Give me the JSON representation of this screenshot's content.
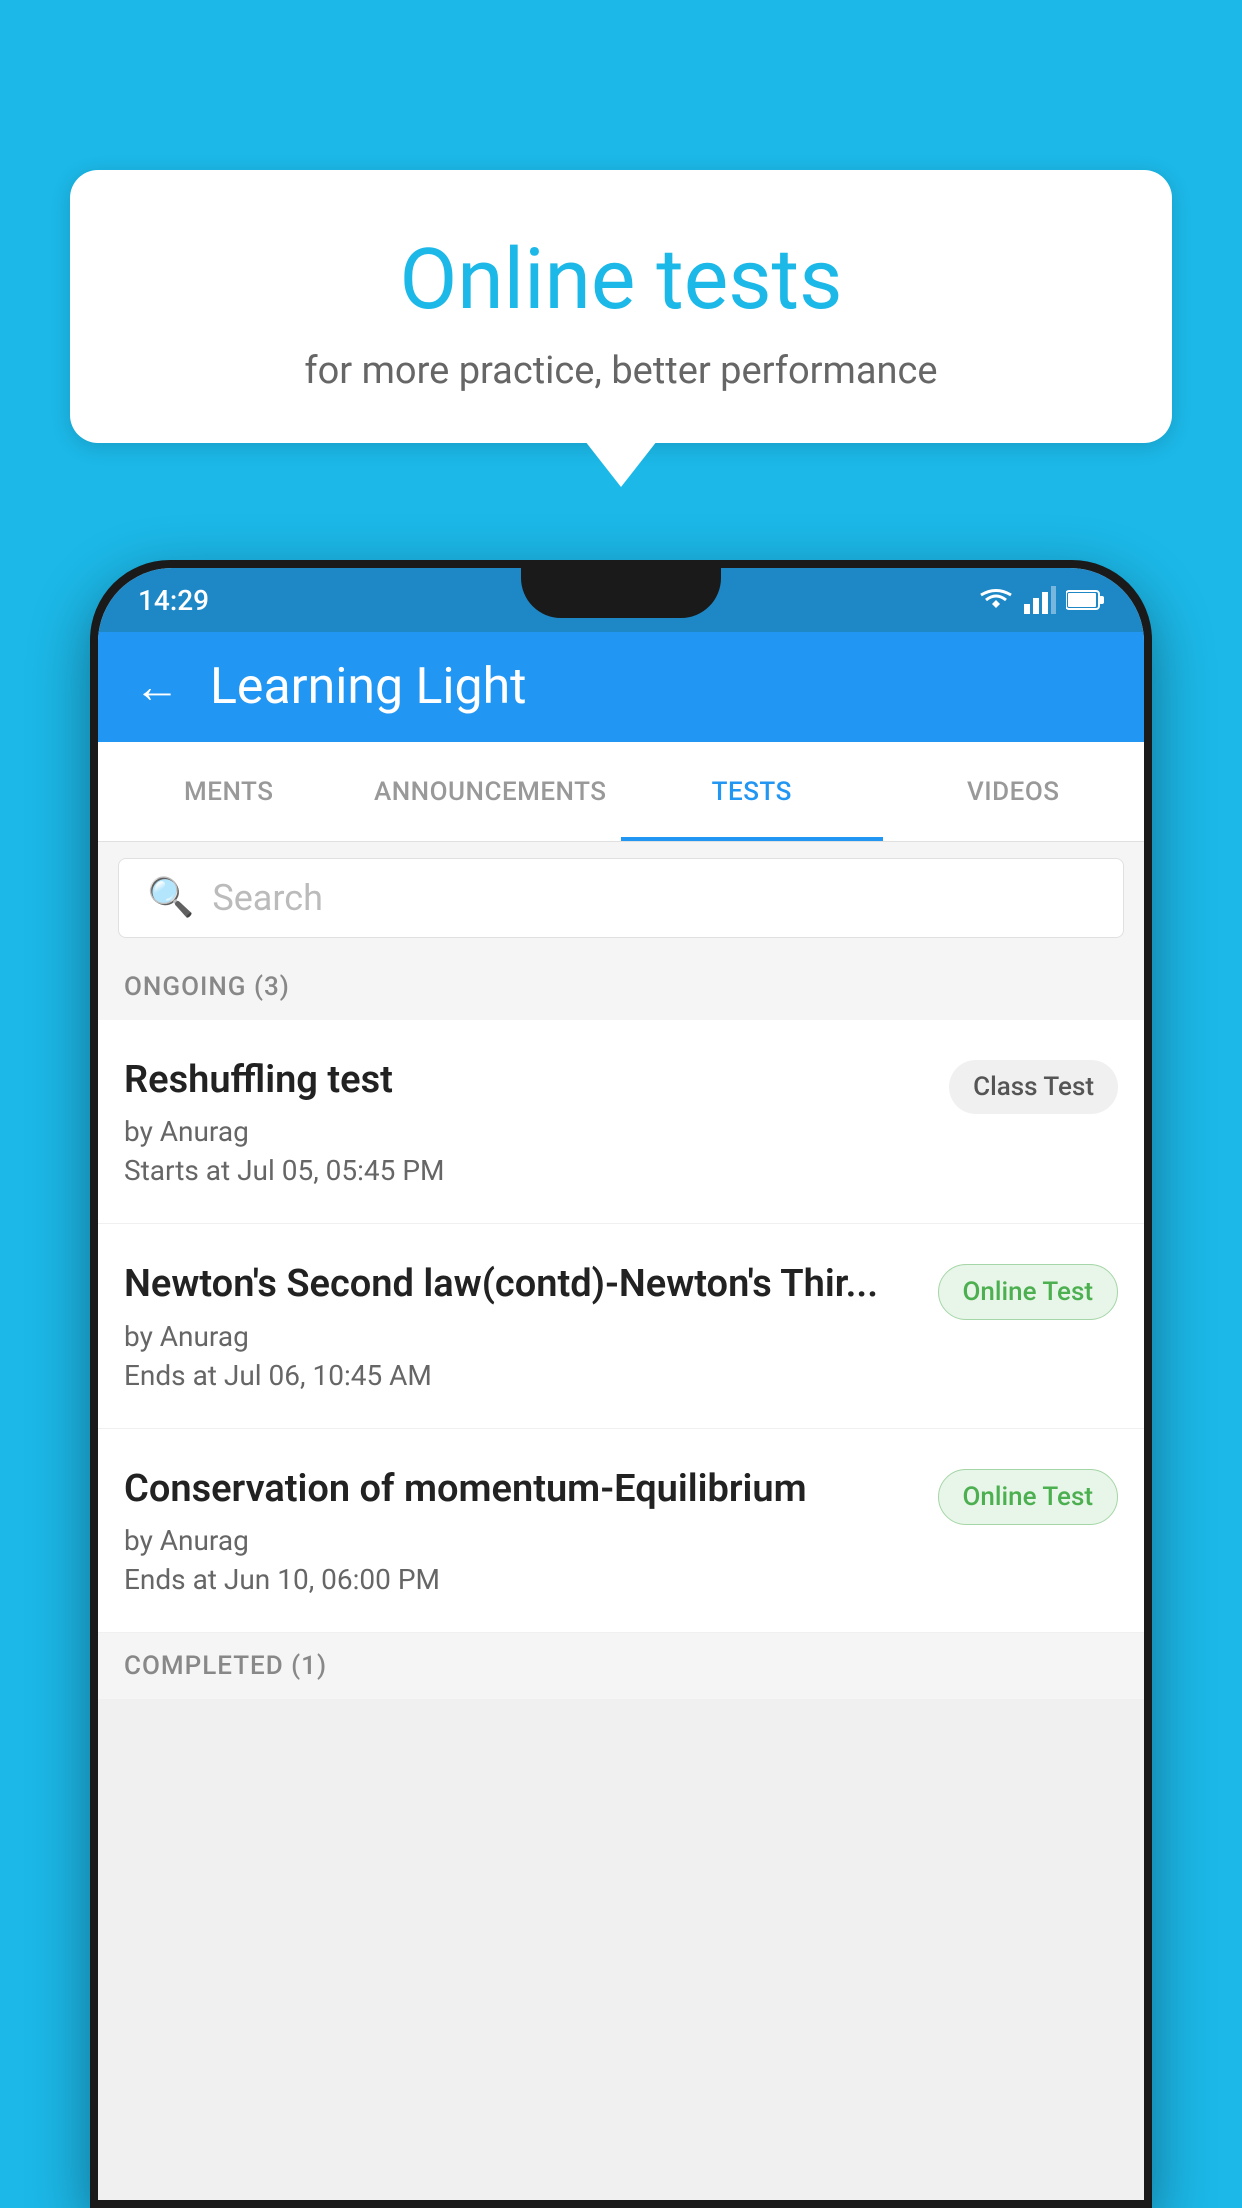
{
  "background": {
    "color": "#1CB8E8"
  },
  "bubble": {
    "title": "Online tests",
    "subtitle": "for more practice, better performance"
  },
  "status_bar": {
    "time": "14:29"
  },
  "app_bar": {
    "title": "Learning Light",
    "back_label": "←"
  },
  "tabs": [
    {
      "label": "MENTS",
      "active": false
    },
    {
      "label": "ANNOUNCEMENTS",
      "active": false
    },
    {
      "label": "TESTS",
      "active": true
    },
    {
      "label": "VIDEOS",
      "active": false
    }
  ],
  "search": {
    "placeholder": "Search"
  },
  "ongoing_section": {
    "label": "ONGOING (3)"
  },
  "tests": [
    {
      "name": "Reshuffling test",
      "author": "by Anurag",
      "time_label": "Starts at",
      "time_value": "Jul 05, 05:45 PM",
      "badge": "Class Test",
      "badge_type": "class"
    },
    {
      "name": "Newton's Second law(contd)-Newton's Thir...",
      "author": "by Anurag",
      "time_label": "Ends at",
      "time_value": "Jul 06, 10:45 AM",
      "badge": "Online Test",
      "badge_type": "online"
    },
    {
      "name": "Conservation of momentum-Equilibrium",
      "author": "by Anurag",
      "time_label": "Ends at",
      "time_value": "Jun 10, 06:00 PM",
      "badge": "Online Test",
      "badge_type": "online"
    }
  ],
  "completed_section": {
    "label": "COMPLETED (1)"
  }
}
